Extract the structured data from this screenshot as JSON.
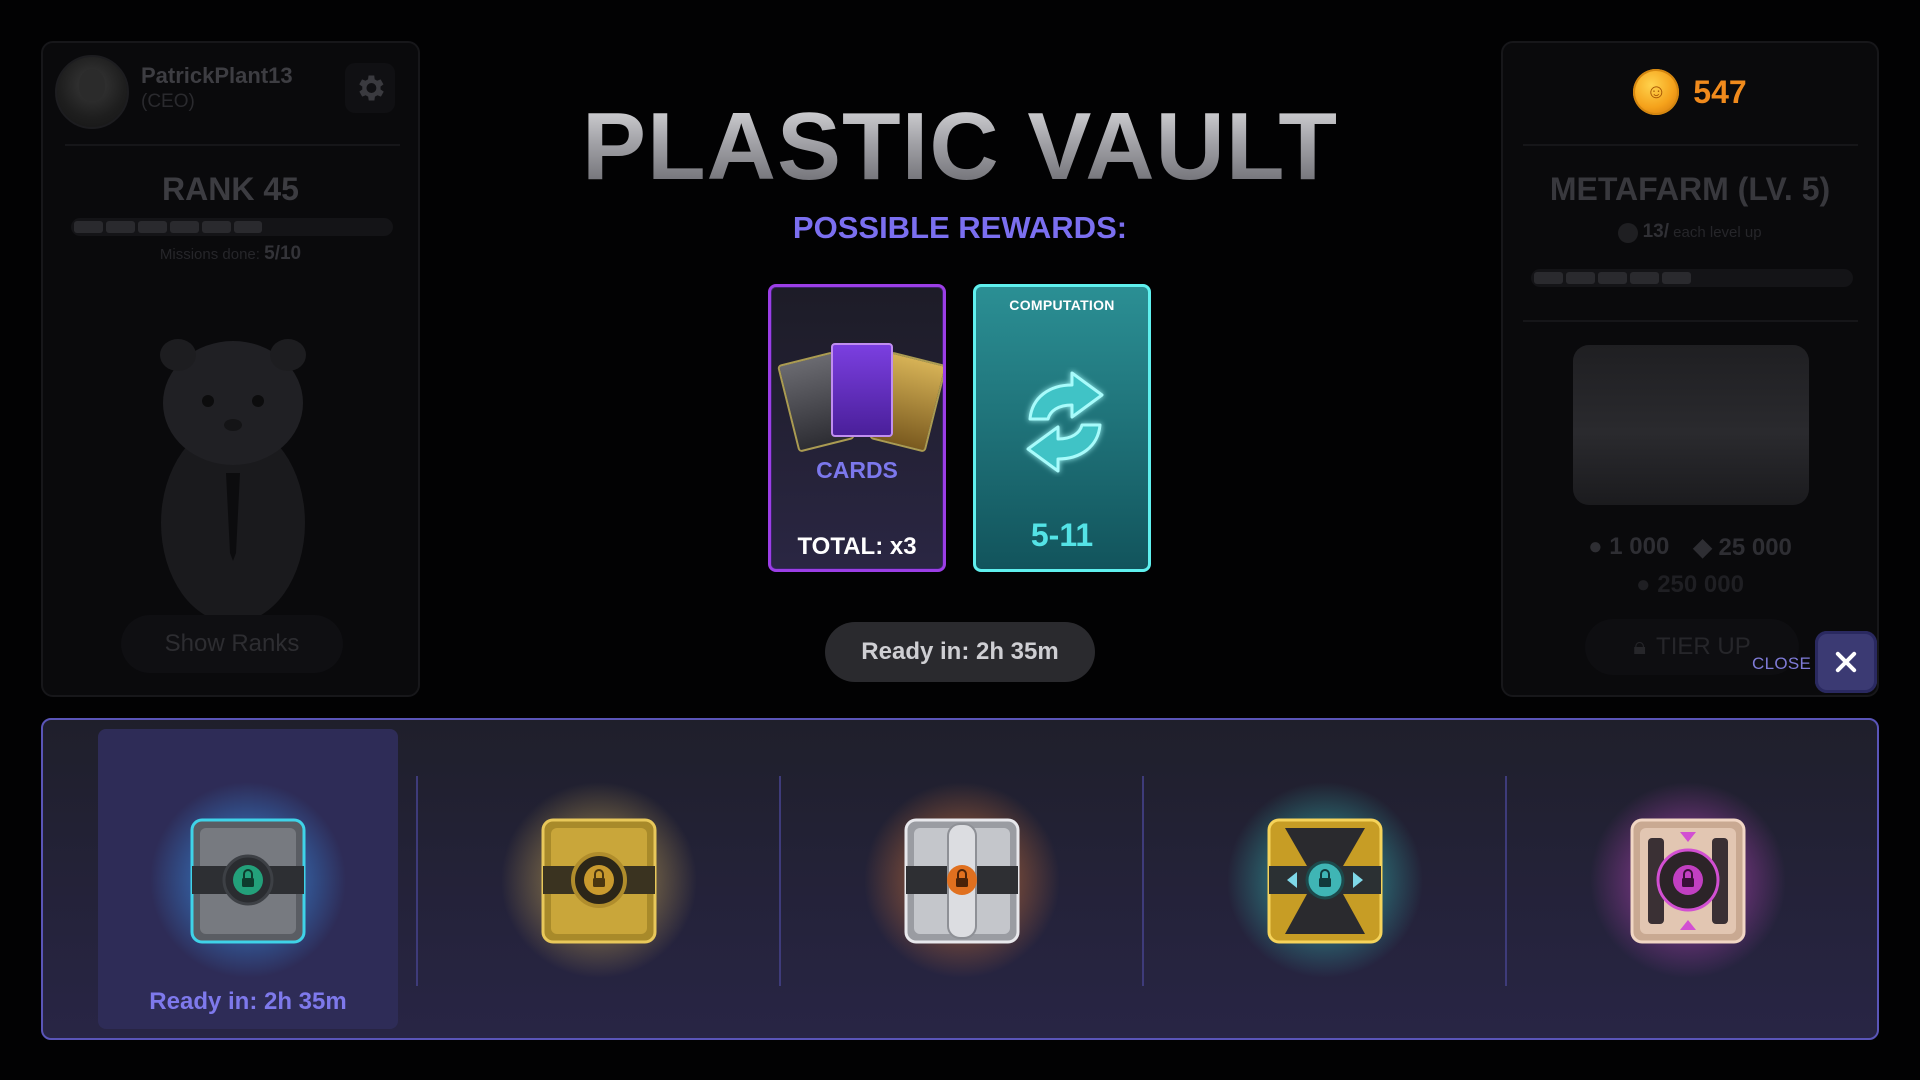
{
  "profile": {
    "username": "PatrickPlant13",
    "role": "(CEO)",
    "rank_label": "RANK 45",
    "rank_segments_filled": 6,
    "rank_segments_total": 10,
    "missions_label": "Missions done:",
    "missions_value": "5/10",
    "show_ranks_label": "Show Ranks"
  },
  "farm": {
    "coins": "547",
    "title": "METAFARM (LV. 5)",
    "per_level_value": "13/",
    "per_level_label": "each level up",
    "progress_fraction": 0.5,
    "cost_a": "1 000",
    "cost_b": "25 000",
    "cost_c": "250 000",
    "tier_up_label": "TIER UP"
  },
  "modal": {
    "title": "PLASTIC VAULT",
    "subtitle": "POSSIBLE REWARDS:",
    "rewards": [
      {
        "label": "CARDS",
        "value": "TOTAL: x3",
        "accent": "#9b3ee6"
      },
      {
        "label": "COMPUTATION",
        "value": "5-11",
        "accent": "#5ff0ee"
      }
    ],
    "ready_text": "Ready in: 2h 35m",
    "close_label": "CLOSE"
  },
  "vaults": {
    "selected_ready_text": "Ready in: 2h 35m",
    "items": [
      {
        "name": "plastic-vault",
        "glow": "#3aa0ff",
        "lock": "#23a07a"
      },
      {
        "name": "gold-vault",
        "glow": "#f2c85a",
        "lock": "#c99a2e"
      },
      {
        "name": "steel-vault",
        "glow": "#ff8a3a",
        "lock": "#e0701f"
      },
      {
        "name": "teal-gold-vault",
        "glow": "#3ae6d8",
        "lock": "#3fb5b5"
      },
      {
        "name": "rose-vault",
        "glow": "#e04fe0",
        "lock": "#c23fc2"
      }
    ]
  }
}
